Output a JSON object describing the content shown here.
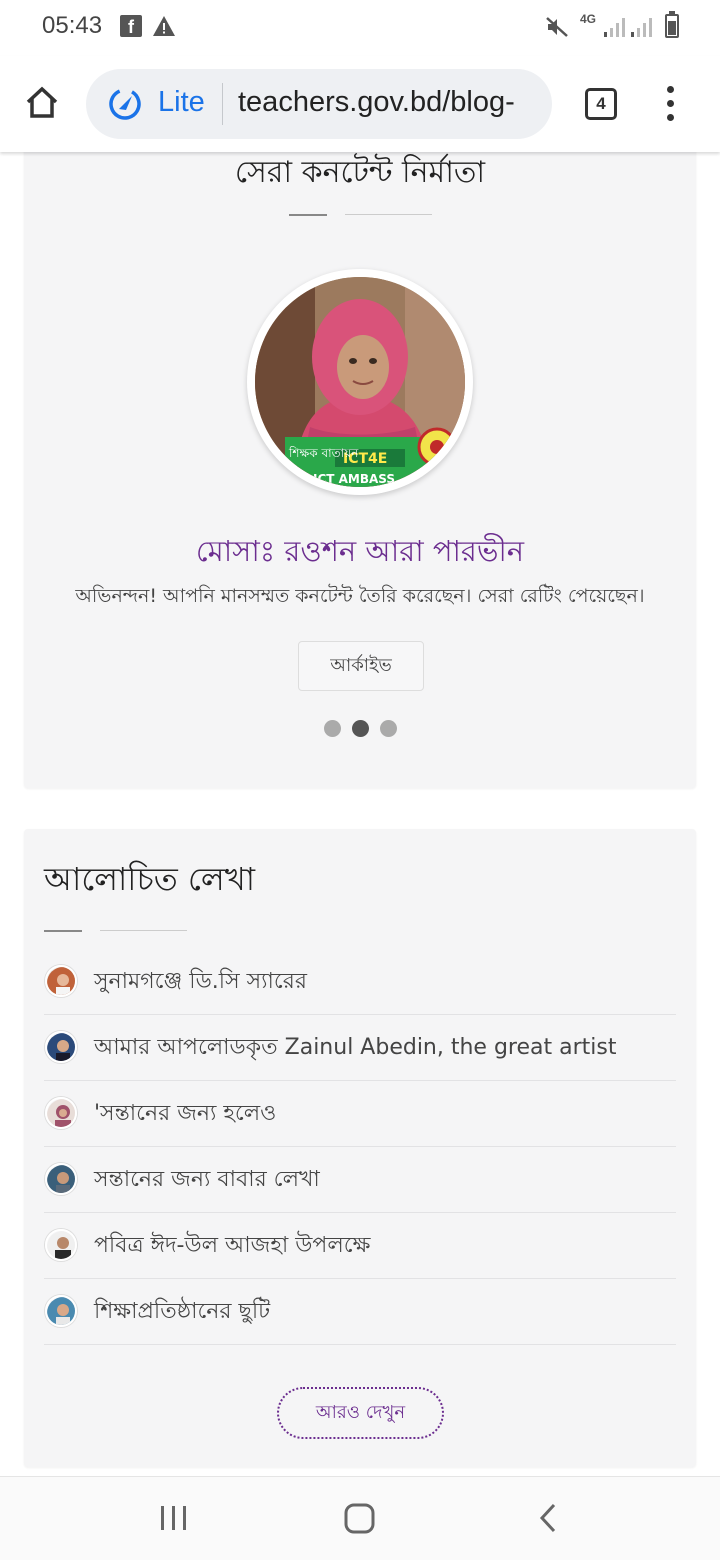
{
  "status_bar": {
    "time": "05:43",
    "network": "4G",
    "icons": [
      "facebook-icon",
      "warning-icon",
      "mute-icon",
      "signal-icon",
      "battery-icon"
    ]
  },
  "browser": {
    "lite_label": "Lite",
    "url": "teachers.gov.bd/blog-",
    "tab_count": "4"
  },
  "top_content": {
    "title": "সেরা কনটেন্ট নির্মাতা",
    "author_name": "মোসাঃ রওশন আরা পারভীন",
    "message": "অভিনন্দন! আপনি মানসম্মত কনটেন্ট তৈরি করেছেন। সেরা রেটিং পেয়েছেন।",
    "archive_label": "আর্কাইভ",
    "avatar_badges": [
      "শিক্ষক বাতায়ন",
      "ICT4E",
      "ICT AMBASS"
    ],
    "carousel": {
      "total": 3,
      "active": 2
    }
  },
  "discussed": {
    "title": "আলোচিত লেখা",
    "items": [
      {
        "text": "সুনামগঞ্জে ডি.সি স্যারের",
        "avatar_color": "#c0623a"
      },
      {
        "text": "আমার আপলোডকৃত Zainul Abedin, the great artist",
        "avatar_color": "#2b4a7a"
      },
      {
        "text": "'সন্তানের জন্য হলেও",
        "avatar_color": "#a0526a"
      },
      {
        "text": "সন্তানের জন্য বাবার লেখা",
        "avatar_color": "#3a5f7a"
      },
      {
        "text": "পবিত্র ঈদ-উল আজহা উপলক্ষে",
        "avatar_color": "#2a2a2a"
      },
      {
        "text": "শিক্ষাপ্রতিষ্ঠানের ছুটি",
        "avatar_color": "#4a8ab0"
      }
    ],
    "more_label": "আরও দেখুন"
  },
  "colors": {
    "accent": "#6b2d8f",
    "lite_blue": "#1a73e8",
    "card_bg": "#f5f5f6"
  }
}
